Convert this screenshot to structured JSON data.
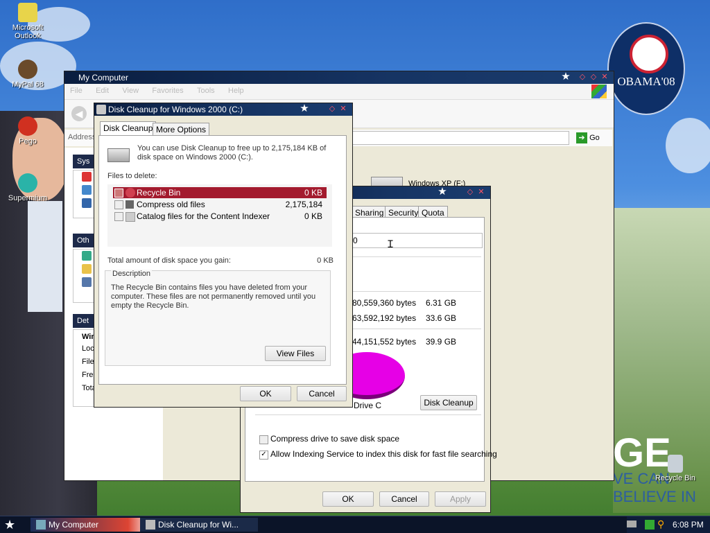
{
  "desktop": {
    "icons": [
      {
        "label": "Microsoft Outlook"
      },
      {
        "label": "MyPal 68"
      },
      {
        "label": "Pego"
      },
      {
        "label": "Supermium"
      },
      {
        "label": "Recycle Bin"
      }
    ],
    "wallpaper": {
      "badge_text": "OBAMA'08",
      "slogan_big": "GE",
      "slogan_small": "VE CAN BELIEVE IN"
    }
  },
  "my_computer": {
    "title": "My Computer",
    "menu": [
      "File",
      "Edit",
      "View",
      "Favorites",
      "Tools",
      "Help"
    ],
    "address_label": "Address",
    "go_label": "Go",
    "drive_label": "Windows XP (F:)",
    "sidebar": {
      "section1_title": "Sys",
      "section2_title": "Oth",
      "section3_title": "Det",
      "details_lines": [
        "Win",
        "Loc",
        "File",
        "Free",
        "Tota"
      ]
    }
  },
  "properties": {
    "tabs": [
      "Sharing",
      "Security",
      "Quota"
    ],
    "label_field_value": "0",
    "rows": [
      {
        "bytes": "80,559,360 bytes",
        "size": "6.31 GB"
      },
      {
        "bytes": "63,592,192 bytes",
        "size": "33.6 GB"
      },
      {
        "bytes": "44,151,552 bytes",
        "size": "39.9 GB"
      }
    ],
    "drive_caption": "Drive C",
    "disk_cleanup_button": "Disk Cleanup",
    "compress_label": "Compress drive to save disk space",
    "compress_checked": false,
    "indexing_label": "Allow Indexing Service to index this disk for fast file searching",
    "indexing_checked": true,
    "ok": "OK",
    "cancel": "Cancel",
    "apply": "Apply",
    "pie_color": "#e600e6"
  },
  "disk_cleanup": {
    "title": "Disk Cleanup for Windows 2000 (C:)",
    "tabs": [
      "Disk Cleanup",
      "More Options"
    ],
    "intro": "You can use Disk Cleanup to free up to 2,175,184 KB of disk space on Windows 2000 (C:).",
    "files_to_delete_label": "Files to delete:",
    "files": [
      {
        "name": "Recycle Bin",
        "size": "0 KB",
        "selected": true
      },
      {
        "name": "Compress old files",
        "size": "2,175,184",
        "selected": false
      },
      {
        "name": "Catalog files for the Content Indexer",
        "size": "0 KB",
        "selected": false
      }
    ],
    "total_label": "Total amount of disk space you gain:",
    "total_value": "0 KB",
    "description_title": "Description",
    "description_text": "The Recycle Bin contains files you have deleted from your computer. These files are not permanently removed until you empty the Recycle Bin.",
    "view_files": "View Files",
    "ok": "OK",
    "cancel": "Cancel"
  },
  "taskbar": {
    "items": [
      "My Computer",
      "Disk Cleanup for Wi..."
    ],
    "clock": "6:08 PM"
  }
}
